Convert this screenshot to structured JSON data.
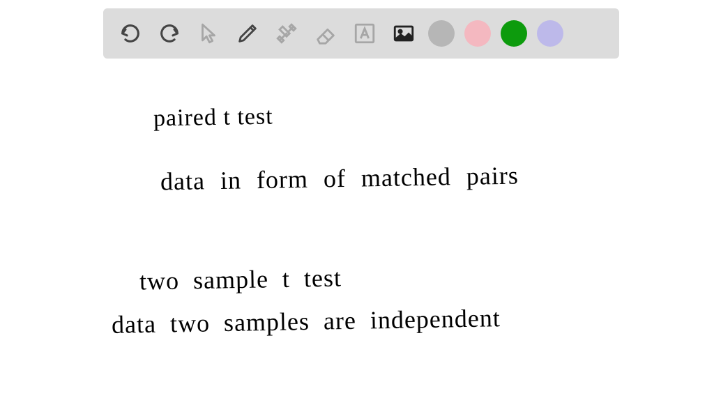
{
  "toolbar": {
    "tools": {
      "undo": "undo",
      "redo": "redo",
      "pointer": "pointer",
      "pencil": "pencil",
      "tools_menu": "tools",
      "eraser": "eraser",
      "text": "text",
      "image": "image"
    },
    "colors": {
      "gray": "#b6b6b6",
      "pink": "#f4b8c0",
      "green": "#0d9b0d",
      "lavender": "#bdb9ea"
    }
  },
  "canvas": {
    "line1": "paired t test",
    "line2": "data in form of matched pairs",
    "line3": "two sample t test",
    "line4": "data two samples are independent"
  }
}
